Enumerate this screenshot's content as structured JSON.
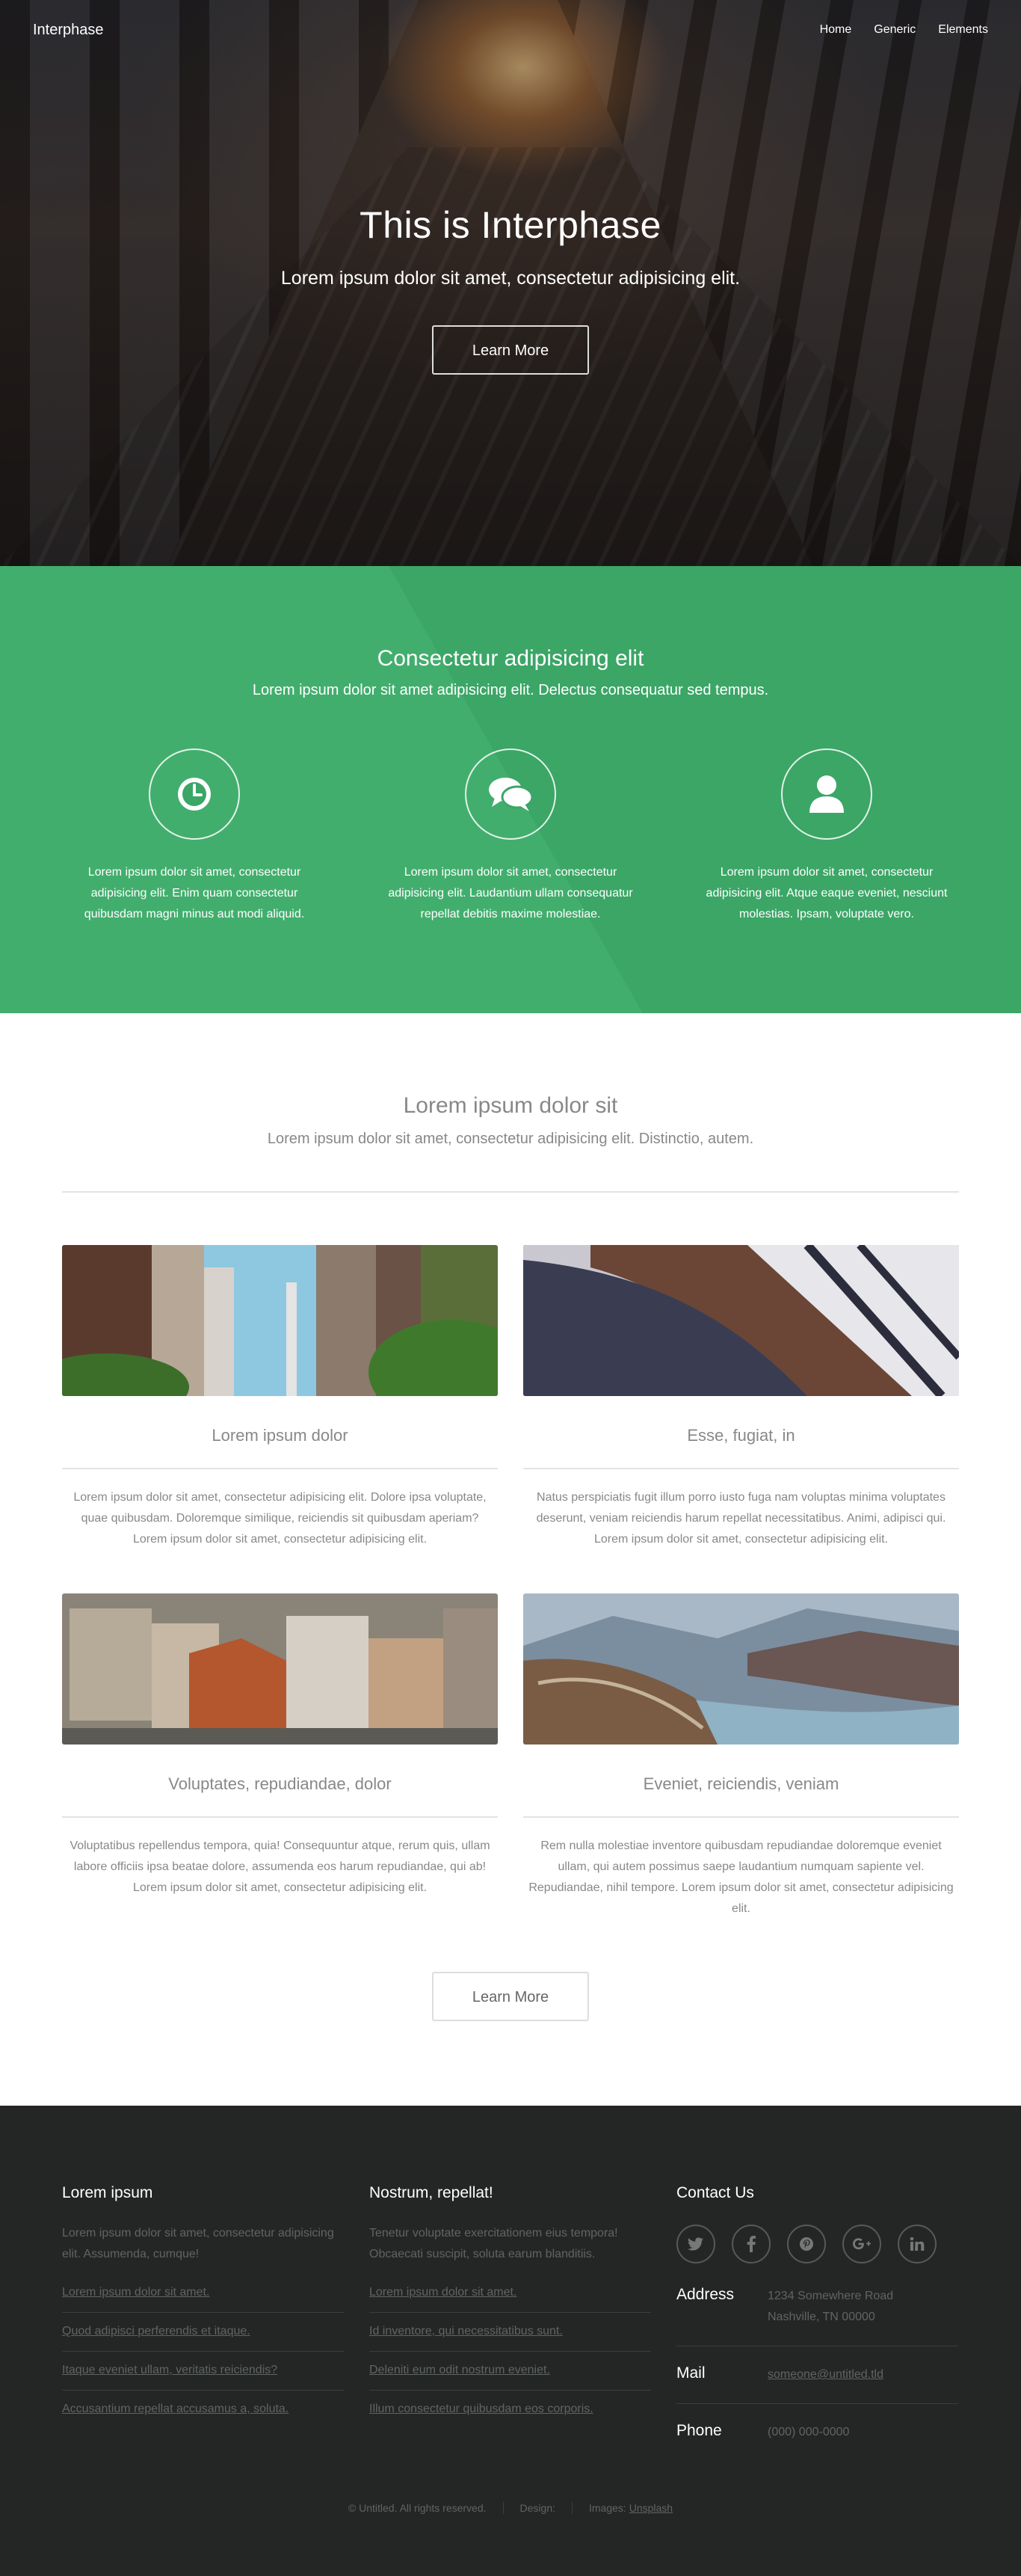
{
  "header": {
    "logo": "Interphase",
    "nav": [
      "Home",
      "Generic",
      "Elements"
    ]
  },
  "banner": {
    "title": "This is Interphase",
    "lead": "Lorem ipsum dolor sit amet, consectetur adipisicing elit.",
    "button": "Learn More"
  },
  "features": {
    "title": "Consectetur adipisicing elit",
    "subtitle": "Lorem ipsum dolor sit amet adipisicing elit. Delectus consequatur sed tempus.",
    "items": [
      {
        "icon": "clock-icon",
        "text": "Lorem ipsum dolor sit amet, consectetur adipisicing elit. Enim quam consectetur quibusdam magni minus aut modi aliquid."
      },
      {
        "icon": "comments-icon",
        "text": "Lorem ipsum dolor sit amet, consectetur adipisicing elit. Laudantium ullam consequatur repellat debitis maxime molestiae."
      },
      {
        "icon": "user-icon",
        "text": "Lorem ipsum dolor sit amet, consectetur adipisicing elit. Atque eaque eveniet, nesciunt molestias. Ipsam, voluptate vero."
      }
    ]
  },
  "two": {
    "title": "Lorem ipsum dolor sit",
    "subtitle": "Lorem ipsum dolor sit amet, consectetur adipisicing elit. Distinctio, autem.",
    "cards": [
      {
        "title": "Lorem ipsum dolor",
        "text": "Lorem ipsum dolor sit amet, consectetur adipisicing elit. Dolore ipsa voluptate, quae quibusdam. Doloremque similique, reiciendis sit quibusdam aperiam? Lorem ipsum dolor sit amet, consectetur adipisicing elit."
      },
      {
        "title": "Esse, fugiat, in",
        "text": "Natus perspiciatis fugit illum porro iusto fuga nam voluptas minima voluptates deserunt, veniam reiciendis harum repellat necessitatibus. Animi, adipisci qui. Lorem ipsum dolor sit amet, consectetur adipisicing elit."
      },
      {
        "title": "Voluptates, repudiandae, dolor",
        "text": "Voluptatibus repellendus tempora, quia! Consequuntur atque, rerum quis, ullam labore officiis ipsa beatae dolore, assumenda eos harum repudiandae, qui ab! Lorem ipsum dolor sit amet, consectetur adipisicing elit."
      },
      {
        "title": "Eveniet, reiciendis, veniam",
        "text": "Rem nulla molestiae inventore quibusdam repudiandae doloremque eveniet ullam, qui autem possimus saepe laudantium numquam sapiente vel. Repudiandae, nihil tempore. Lorem ipsum dolor sit amet, consectetur adipisicing elit."
      }
    ],
    "button": "Learn More"
  },
  "footer": {
    "col1": {
      "title": "Lorem ipsum",
      "text": "Lorem ipsum dolor sit amet, consectetur adipisicing elit. Assumenda, cumque!",
      "links": [
        "Lorem ipsum dolor sit amet.",
        "Quod adipisci perferendis et itaque.",
        "Itaque eveniet ullam, veritatis reiciendis?",
        "Accusantium repellat accusamus a, soluta."
      ]
    },
    "col2": {
      "title": "Nostrum, repellat!",
      "text": "Tenetur voluptate exercitationem eius tempora! Obcaecati suscipit, soluta earum blanditiis.",
      "links": [
        "Lorem ipsum dolor sit amet.",
        "Id inventore, qui necessitatibus sunt.",
        "Deleniti eum odit nostrum eveniet.",
        "Illum consectetur quibusdam eos corporis."
      ]
    },
    "col3": {
      "title": "Contact Us",
      "social": [
        "twitter-icon",
        "facebook-icon",
        "pinterest-icon",
        "google-plus-icon",
        "linkedin-icon"
      ],
      "address_label": "Address",
      "address_line1": "1234 Somewhere Road",
      "address_line2": "Nashville, TN 00000",
      "mail_label": "Mail",
      "mail": "someone@untitled.tld",
      "phone_label": "Phone",
      "phone": "(000) 000-0000"
    },
    "copyright": "© Untitled. All rights reserved.",
    "design_label": "Design:",
    "images_label": "Images:",
    "images_link": "Unsplash"
  }
}
